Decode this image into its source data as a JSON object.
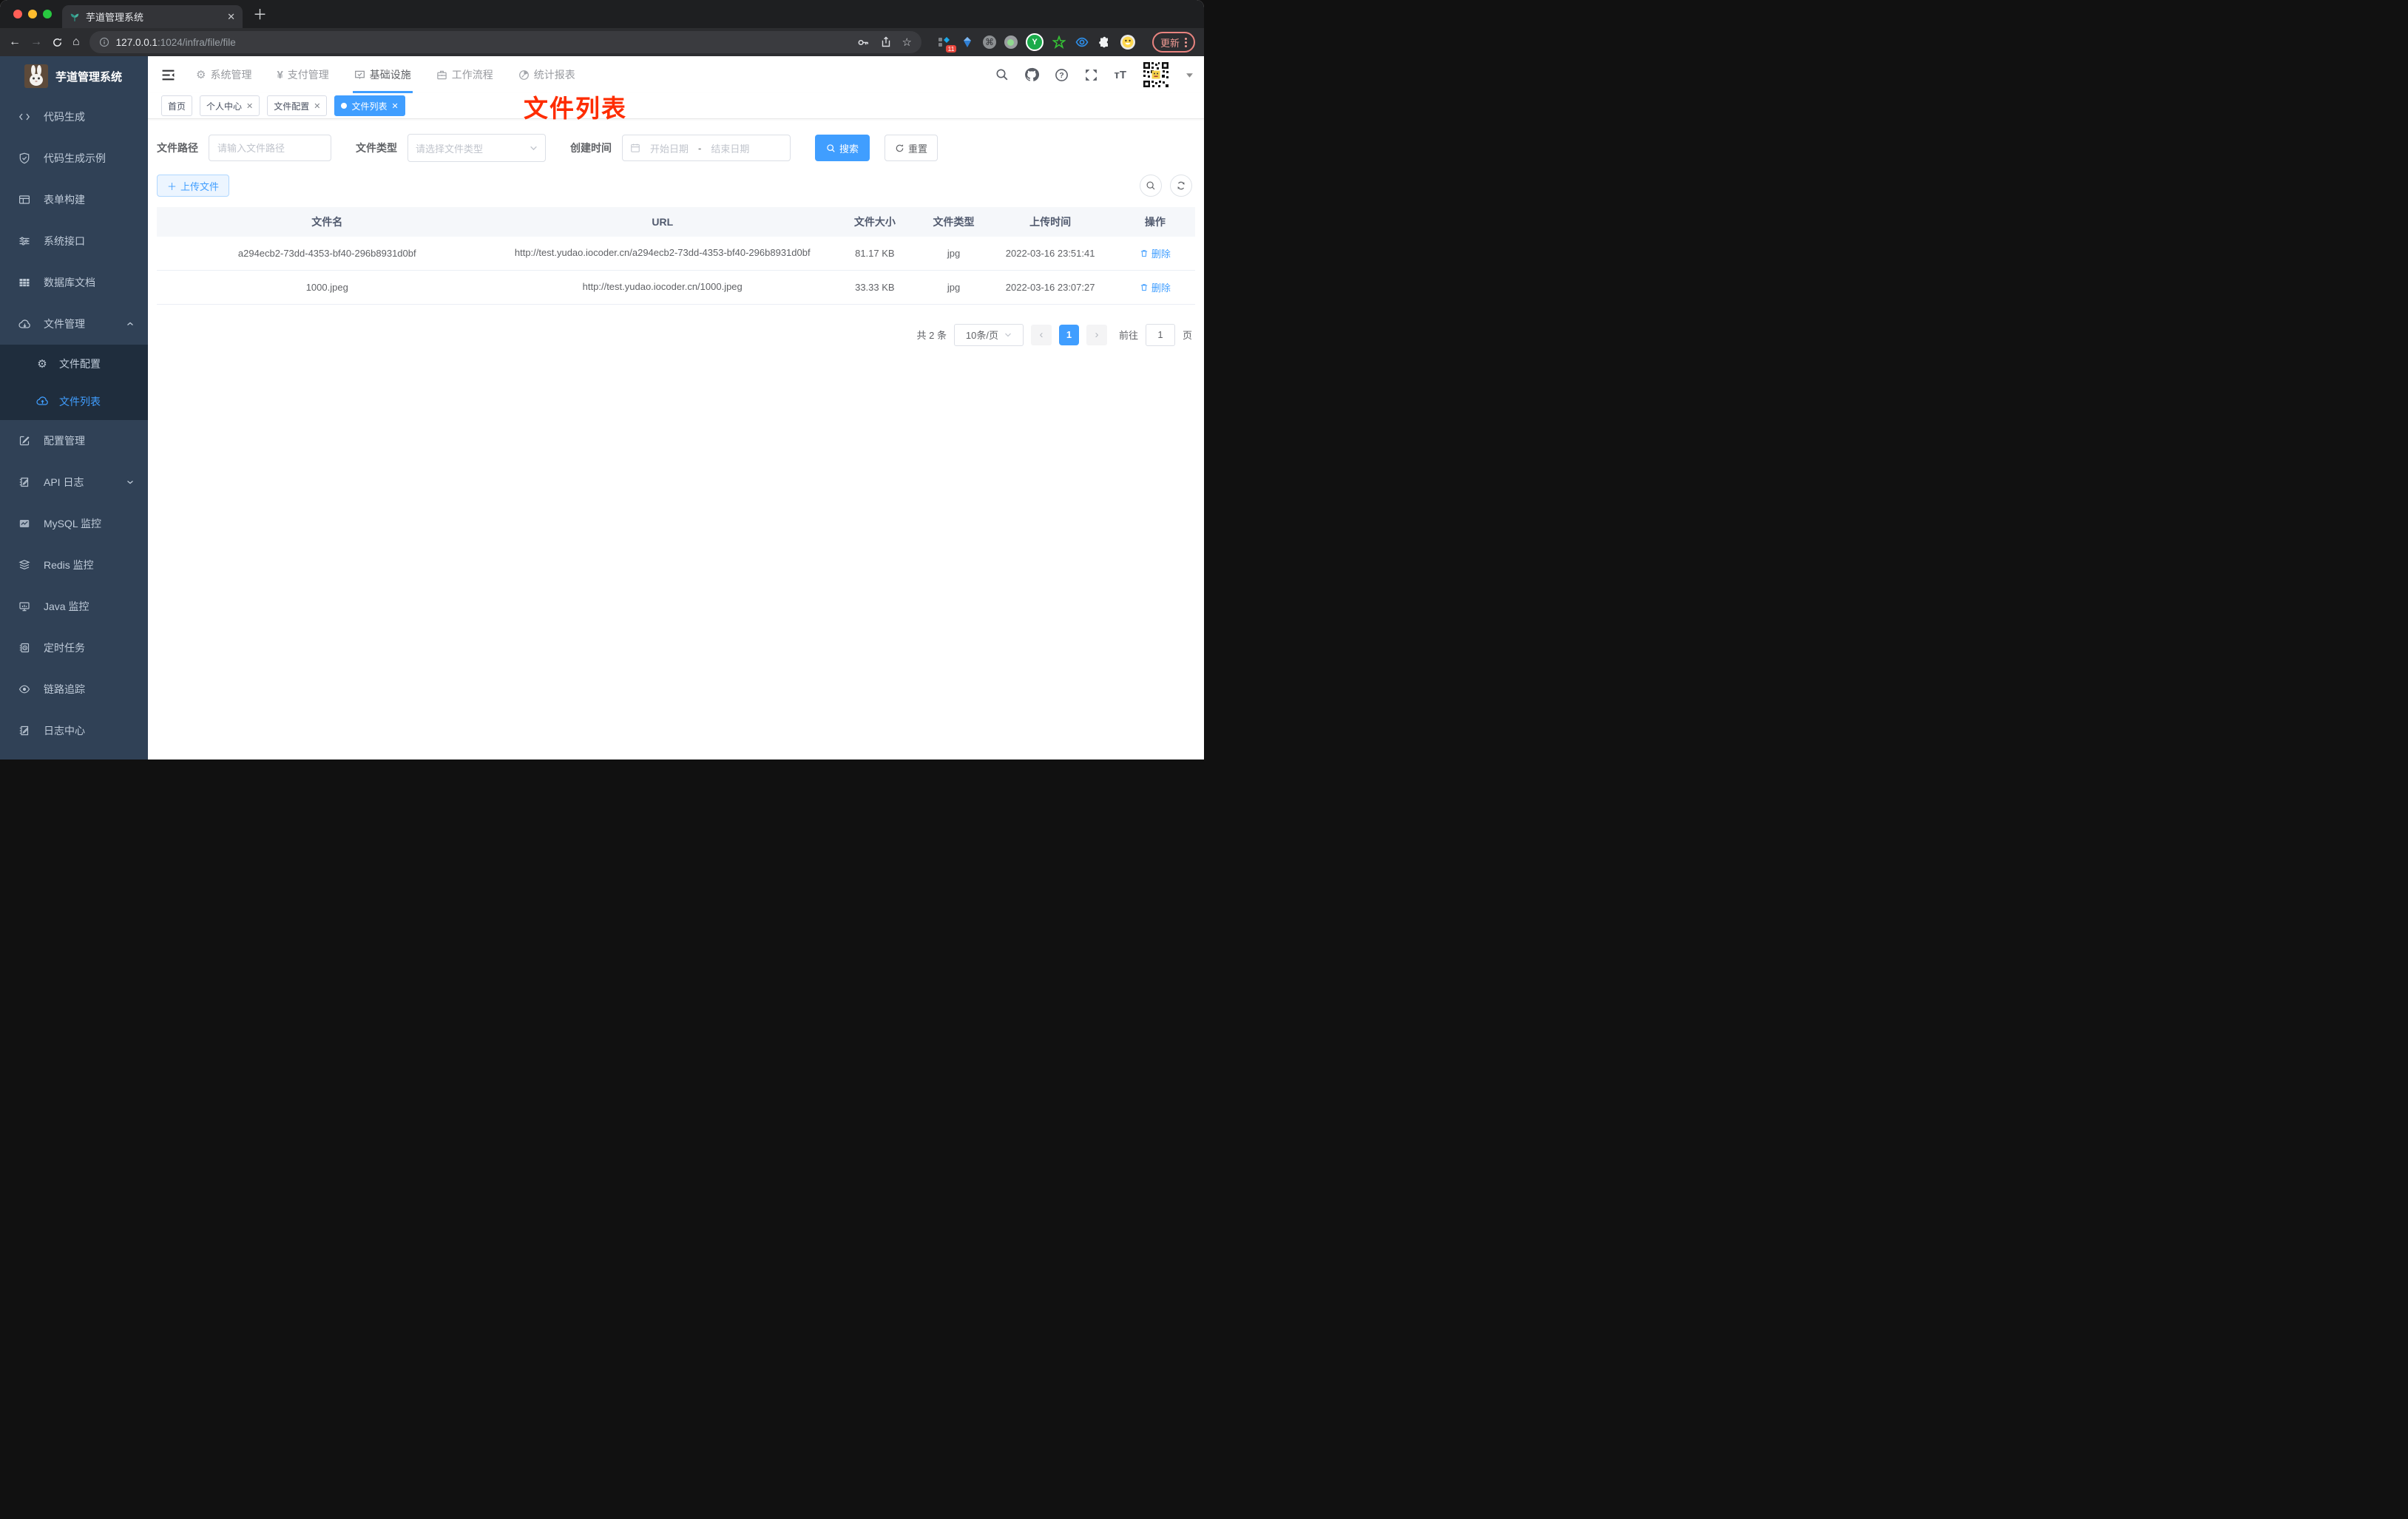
{
  "browser": {
    "tab_title": "芋道管理系统",
    "url_host": "127.0.0.1",
    "url_rest": ":1024/infra/file/file",
    "ext_badge": "11",
    "ext_y_label": "Y",
    "update_label": "更新"
  },
  "header": {
    "menus": [
      {
        "label": "系统管理",
        "icon": "gear-icon"
      },
      {
        "label": "支付管理",
        "icon": "yen-icon"
      },
      {
        "label": "基础设施",
        "icon": "infra-icon",
        "active": true
      },
      {
        "label": "工作流程",
        "icon": "workflow-icon"
      },
      {
        "label": "统计报表",
        "icon": "report-icon"
      }
    ]
  },
  "tags": [
    {
      "label": "首页",
      "closable": false,
      "active": false
    },
    {
      "label": "个人中心",
      "closable": true,
      "active": false
    },
    {
      "label": "文件配置",
      "closable": true,
      "active": false
    },
    {
      "label": "文件列表",
      "closable": true,
      "active": true
    }
  ],
  "annotation": {
    "text": "文件列表",
    "color": "#fe2c00"
  },
  "sidebar": {
    "title": "芋道管理系统",
    "items": [
      {
        "label": "代码生成",
        "icon": "code-icon"
      },
      {
        "label": "代码生成示例",
        "icon": "shield-check-icon"
      },
      {
        "label": "表单构建",
        "icon": "form-grid-icon"
      },
      {
        "label": "系统接口",
        "icon": "sliders-icon"
      },
      {
        "label": "数据库文档",
        "icon": "table-filled-icon"
      },
      {
        "label": "文件管理",
        "icon": "cloud-download-icon",
        "expanded": true
      }
    ],
    "submenu": [
      {
        "label": "文件配置",
        "icon": "gear-icon",
        "active": false
      },
      {
        "label": "文件列表",
        "icon": "cloud-upload-icon",
        "active": true
      }
    ],
    "items2": [
      {
        "label": "配置管理",
        "icon": "edit-square-icon"
      },
      {
        "label": "API 日志",
        "icon": "doc-pencil-icon",
        "collapsed": true
      },
      {
        "label": "MySQL 监控",
        "icon": "chart-line-icon"
      },
      {
        "label": "Redis 监控",
        "icon": "layers-icon"
      },
      {
        "label": "Java 监控",
        "icon": "monitor-icon"
      },
      {
        "label": "定时任务",
        "icon": "clock-doc-icon"
      },
      {
        "label": "链路追踪",
        "icon": "eye-icon"
      },
      {
        "label": "日志中心",
        "icon": "doc-pencil-icon"
      }
    ]
  },
  "filters": {
    "path_label": "文件路径",
    "path_placeholder": "请输入文件路径",
    "type_label": "文件类型",
    "type_placeholder": "请选择文件类型",
    "date_label": "创建时间",
    "date_start": "开始日期",
    "date_sep": "-",
    "date_end": "结束日期",
    "search_label": "搜索",
    "reset_label": "重置"
  },
  "toolbar": {
    "upload_label": "上传文件"
  },
  "table": {
    "headers": [
      "文件名",
      "URL",
      "文件大小",
      "文件类型",
      "上传时间",
      "操作"
    ],
    "delete_label": "删除",
    "rows": [
      {
        "name": "a294ecb2-73dd-4353-bf40-296b8931d0bf",
        "url": "http://test.yudao.iocoder.cn/a294ecb2-73dd-4353-bf40-296b8931d0bf",
        "size": "81.17 KB",
        "type": "jpg",
        "time": "2022-03-16 23:51:41"
      },
      {
        "name": "1000.jpeg",
        "url": "http://test.yudao.iocoder.cn/1000.jpeg",
        "size": "33.33 KB",
        "type": "jpg",
        "time": "2022-03-16 23:07:27"
      }
    ]
  },
  "pagination": {
    "total": "共 2 条",
    "size": "10条/页",
    "prev": "‹",
    "page": "1",
    "next": "›",
    "goto": "前往",
    "goto_value": "1",
    "unit": "页"
  },
  "colors": {
    "accent": "#409eff",
    "sidebar_bg": "#304156",
    "submenu_bg": "#1f2d3d",
    "annotation": "#fe2c00",
    "update_pill": "#e8837f"
  }
}
